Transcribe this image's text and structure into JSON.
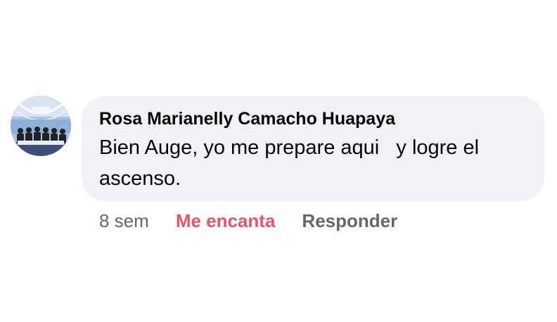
{
  "comment": {
    "author": "Rosa Marianelly Camacho Huapaya",
    "text": "Bien Auge, yo me prepare aqui   y logre el ascenso.",
    "timestamp": "8 sem",
    "reaction_label": "Me encanta",
    "reply_label": "Responder",
    "avatar_icon": "group-photo-avatar"
  },
  "colors": {
    "bubble_bg": "#f0f2f5",
    "reaction": "#e4546a",
    "meta": "#65676b",
    "text": "#050505"
  }
}
